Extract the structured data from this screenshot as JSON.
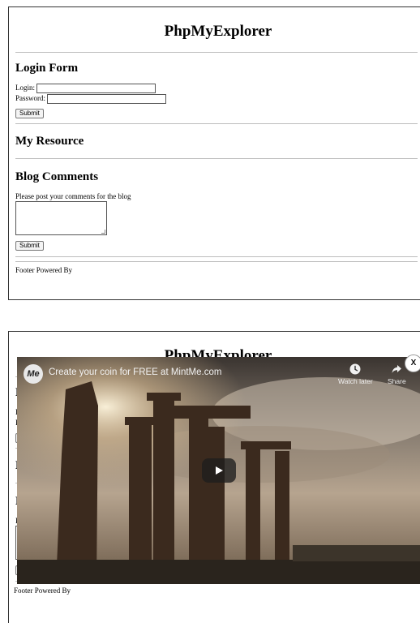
{
  "page": {
    "title": "PhpMyExplorer",
    "login_form": {
      "heading": "Login Form",
      "login_label": "Login:",
      "password_label": "Password:",
      "submit_label": "Submit"
    },
    "resource": {
      "heading": "My Resource"
    },
    "blog": {
      "heading": "Blog Comments",
      "prompt": "Please post your comments for the blog",
      "submit_label": "Submit"
    },
    "footer": "Footer Powered By"
  },
  "overlay": {
    "channel_logo": "Me",
    "video_title": "Create your coin for FREE at MintMe.com",
    "watch_later_label": "Watch later",
    "share_label": "Share",
    "close_label": "X",
    "play_icon": "play-icon"
  }
}
